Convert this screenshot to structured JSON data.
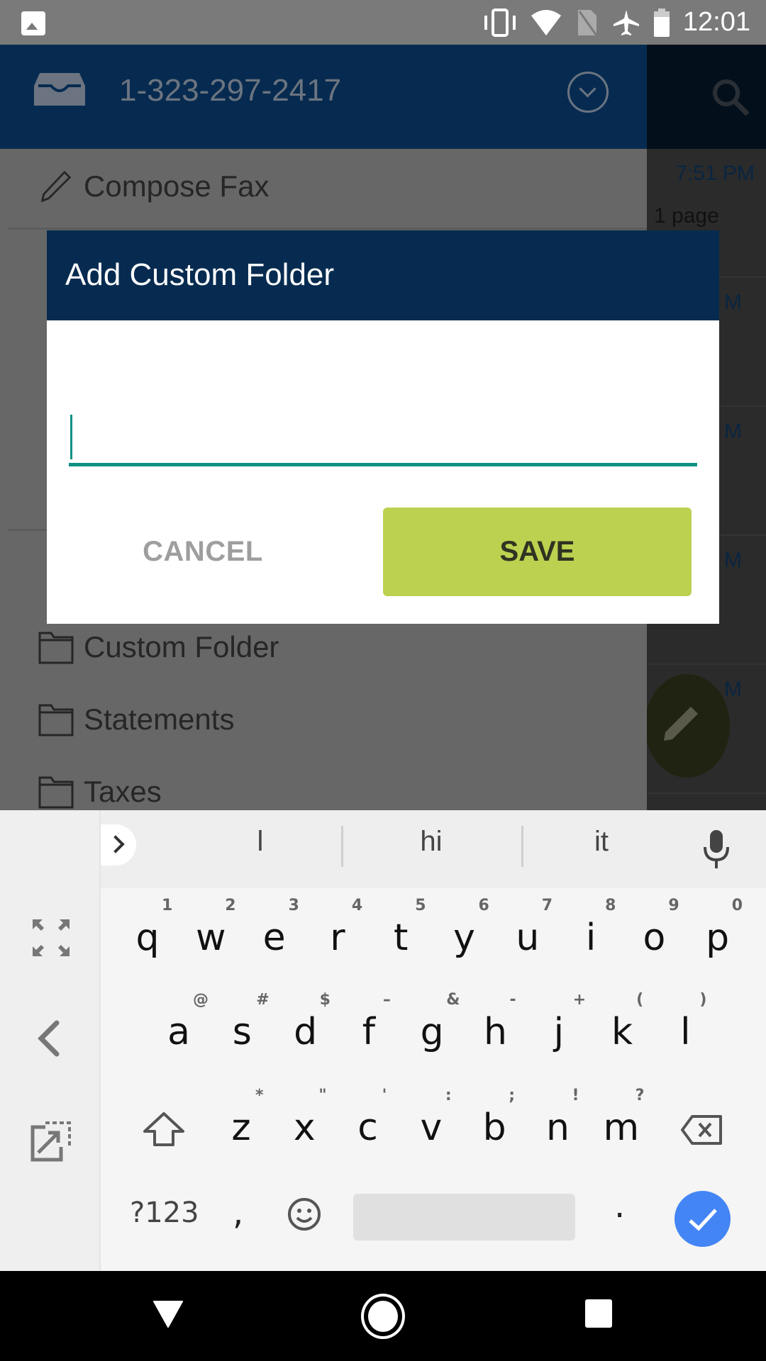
{
  "status_bar": {
    "time": "12:01",
    "icons": [
      "image-notification-icon",
      "vibrate-icon",
      "wifi-icon",
      "no-sim-icon",
      "airplane-mode-icon",
      "battery-icon"
    ]
  },
  "drawer": {
    "account_number": "1-323-297-2417",
    "compose_label": "Compose Fax",
    "folders": [
      {
        "label": "Custom Folder",
        "icon": "folder-icon"
      },
      {
        "label": "Statements",
        "icon": "folder-icon"
      },
      {
        "label": "Taxes",
        "icon": "folder-icon"
      }
    ]
  },
  "background_list": {
    "first_time_fragment": "7:51 PM",
    "first_pages": "1 page",
    "time_fragment": "M"
  },
  "dialog": {
    "title": "Add Custom Folder",
    "input_value": "",
    "input_placeholder": "",
    "cancel_label": "CANCEL",
    "save_label": "SAVE",
    "colors": {
      "header": "#072b50",
      "accent": "#0c9182",
      "save_bg": "#bcd14f"
    }
  },
  "keyboard": {
    "suggestions": [
      "l",
      "hi",
      "it"
    ],
    "rows": [
      [
        {
          "k": "q",
          "h": "1"
        },
        {
          "k": "w",
          "h": "2"
        },
        {
          "k": "e",
          "h": "3"
        },
        {
          "k": "r",
          "h": "4"
        },
        {
          "k": "t",
          "h": "5"
        },
        {
          "k": "y",
          "h": "6"
        },
        {
          "k": "u",
          "h": "7"
        },
        {
          "k": "i",
          "h": "8"
        },
        {
          "k": "o",
          "h": "9"
        },
        {
          "k": "p",
          "h": "0"
        }
      ],
      [
        {
          "k": "a",
          "h": "@"
        },
        {
          "k": "s",
          "h": "#"
        },
        {
          "k": "d",
          "h": "$"
        },
        {
          "k": "f",
          "h": "–"
        },
        {
          "k": "g",
          "h": "&"
        },
        {
          "k": "h",
          "h": "-"
        },
        {
          "k": "j",
          "h": "+"
        },
        {
          "k": "k",
          "h": "("
        },
        {
          "k": "l",
          "h": ")"
        }
      ],
      [
        {
          "k": "z",
          "h": "*"
        },
        {
          "k": "x",
          "h": "\""
        },
        {
          "k": "c",
          "h": "'"
        },
        {
          "k": "v",
          "h": ":"
        },
        {
          "k": "b",
          "h": ";"
        },
        {
          "k": "n",
          "h": "!"
        },
        {
          "k": "m",
          "h": "?"
        }
      ]
    ],
    "symbols_label": "?123",
    "comma_label": ",",
    "period_label": "."
  }
}
